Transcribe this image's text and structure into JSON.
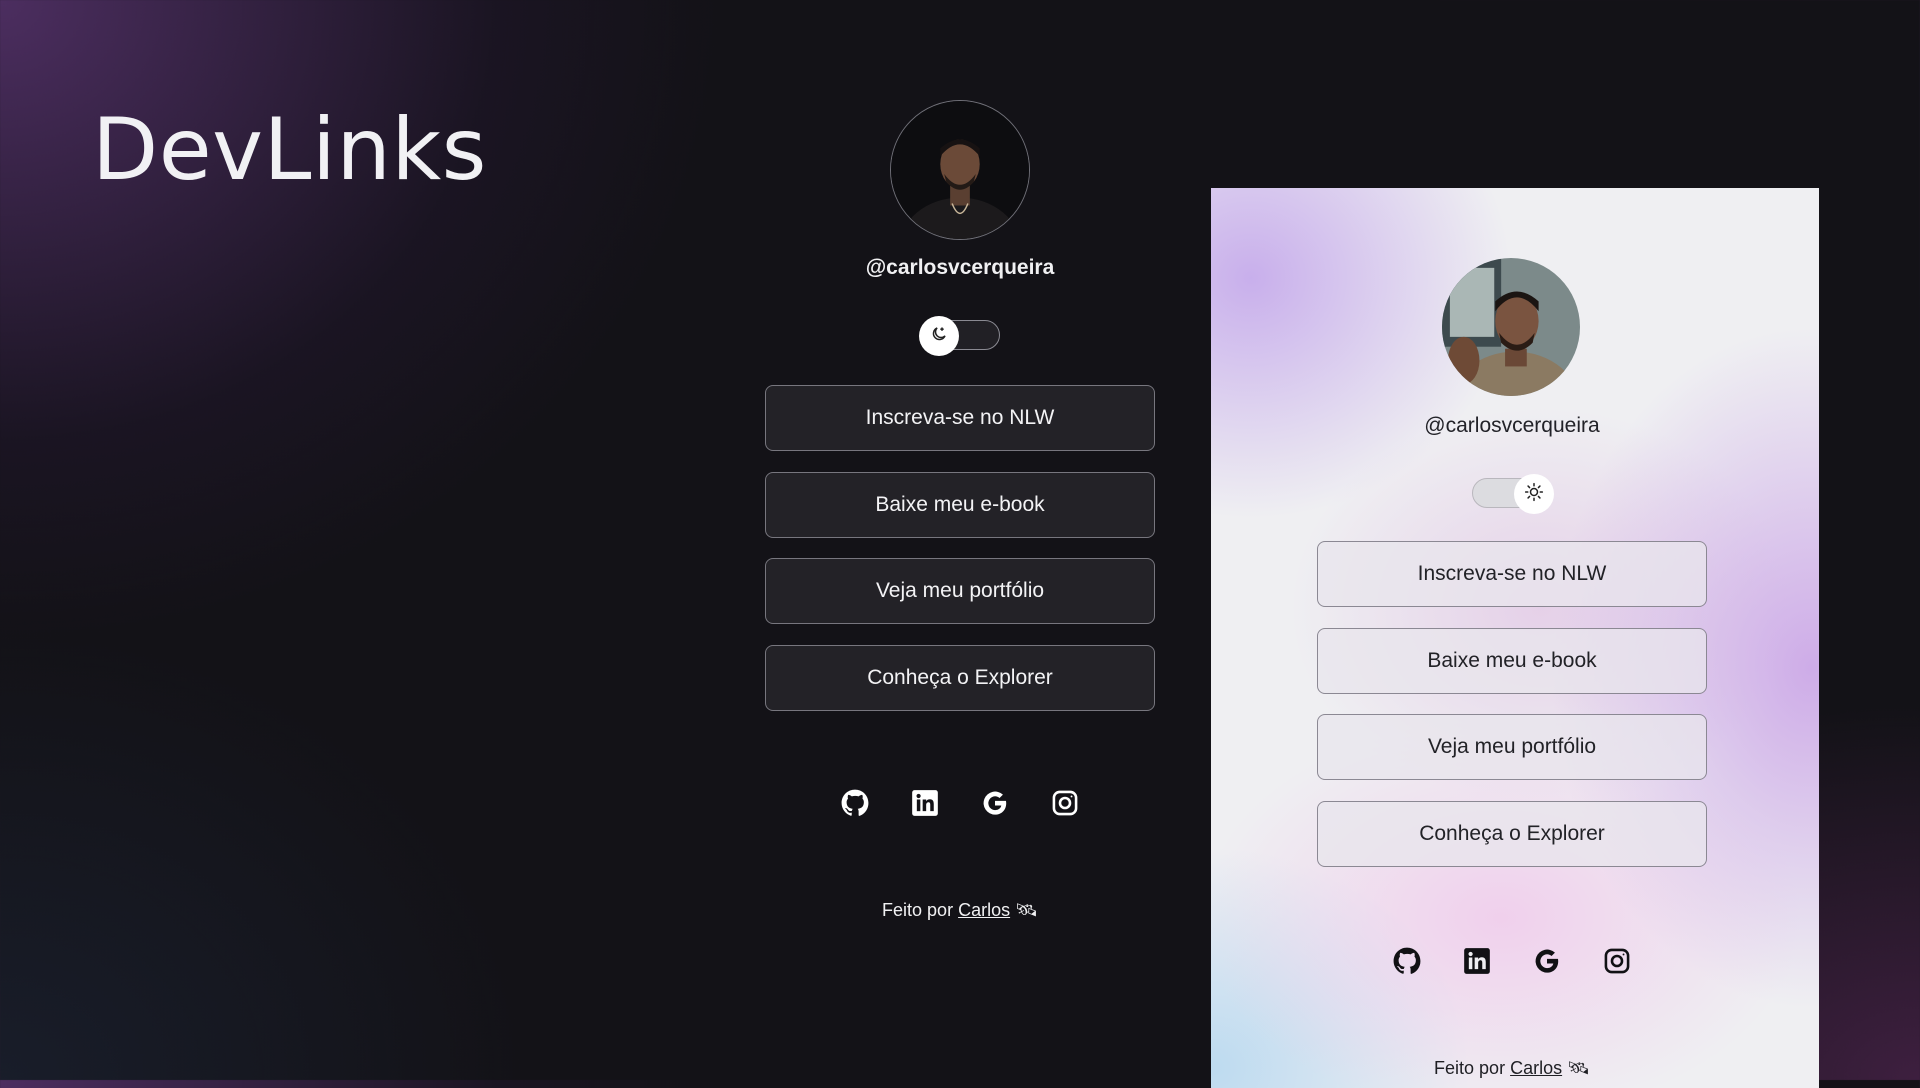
{
  "page": {
    "title": "DevLinks"
  },
  "dark_profile": {
    "handle": "@carlosvcerqueira",
    "theme_icon": "moon-icon",
    "buttons": [
      {
        "label": "Inscreva-se no NLW"
      },
      {
        "label": "Baixe meu e-book"
      },
      {
        "label": "Veja meu portfólio"
      },
      {
        "label": "Conheça o Explorer"
      }
    ],
    "socials": [
      "github-icon",
      "linkedin-icon",
      "google-icon",
      "instagram-icon"
    ],
    "footer": {
      "prefix": "Feito por ",
      "author": "Carlos",
      "emoji": "🛰"
    }
  },
  "light_profile": {
    "handle": "@carlosvcerqueira",
    "theme_icon": "sun-icon",
    "buttons": [
      {
        "label": "Inscreva-se no NLW"
      },
      {
        "label": "Baixe meu e-book"
      },
      {
        "label": "Veja meu portfólio"
      },
      {
        "label": "Conheça o Explorer"
      }
    ],
    "socials": [
      "github-icon",
      "linkedin-icon",
      "google-icon",
      "instagram-icon"
    ],
    "footer": {
      "prefix": "Feito por ",
      "author": "Carlos",
      "emoji": "🛰"
    }
  },
  "colors": {
    "background": "#131217",
    "dark_button": "#232227",
    "light_panel": "#efeff2",
    "accent_purple": "#c4a8eb"
  }
}
